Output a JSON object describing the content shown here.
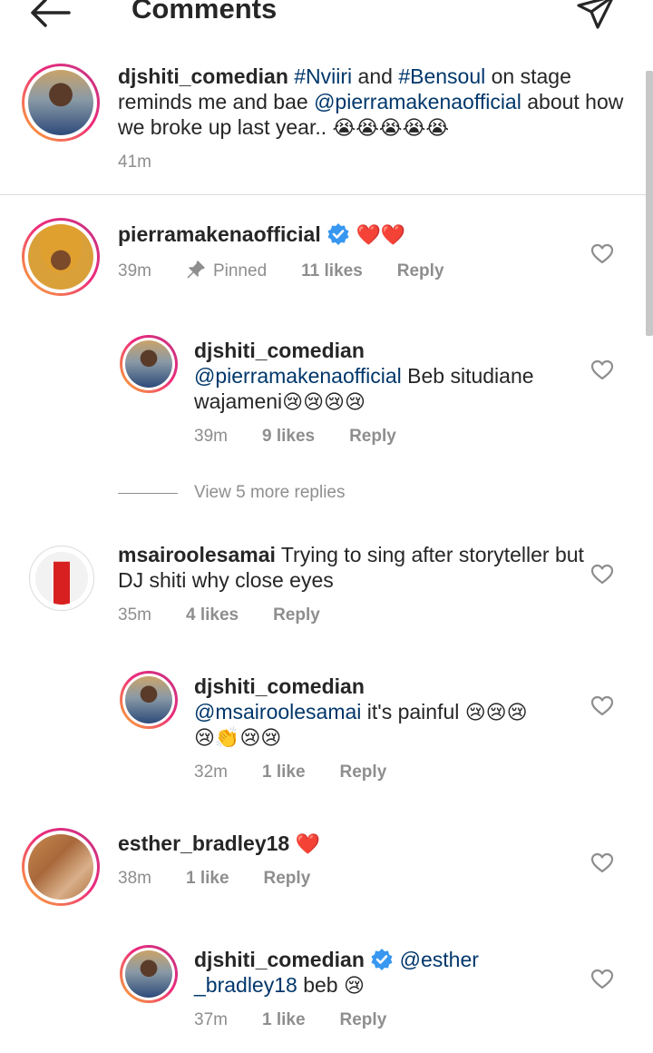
{
  "header": {
    "title": "Comments",
    "back_icon": "arrow-left-icon",
    "send_icon": "paper-plane-icon"
  },
  "caption": {
    "username": "djshiti_comedian",
    "tag1": "#Nviiri",
    "word_and": "and",
    "tag2": "#Bensoul",
    "text1": "on stage reminds me and bae",
    "mention": "@pierramakenaofficial",
    "text2": "about how we broke up last year..",
    "emojis": "😭😭😭😭😭",
    "time": "41m"
  },
  "comments": [
    {
      "username": "pierramakenaofficial",
      "verified": true,
      "text": "❤️❤️",
      "time": "39m",
      "pinned": "Pinned",
      "likes": "11 likes",
      "reply": "Reply",
      "replies": [
        {
          "username": "djshiti_comedian",
          "mention": "@pierramakenaofficial",
          "text": "Beb situdiane wajameni",
          "emojis": "😢😢😢😢",
          "time": "39m",
          "likes": "9 likes",
          "reply": "Reply"
        }
      ],
      "view_more": "View 5 more replies"
    },
    {
      "username": "msairoolesamai",
      "text": "Trying to sing after storyteller but DJ shiti why close eyes",
      "time": "35m",
      "likes": "4 likes",
      "reply": "Reply",
      "replies": [
        {
          "username": "djshiti_comedian",
          "mention": "@msairoolesamai",
          "text": "it's painful",
          "emojis1": "😢😢😢",
          "emojis2": "😢👏😢😢",
          "time": "32m",
          "likes": "1 like",
          "reply": "Reply"
        }
      ]
    },
    {
      "username": "esther_bradley18",
      "text": "❤️",
      "time": "38m",
      "likes": "1 like",
      "reply": "Reply",
      "replies": [
        {
          "username": "djshiti_comedian",
          "verified": true,
          "mention1": "@esther",
          "mention2": "_bradley18",
          "text": "beb",
          "emojis": "😢",
          "time": "37m",
          "likes": "1 like",
          "reply": "Reply"
        }
      ]
    }
  ],
  "colors": {
    "link": "#00376b",
    "meta": "#8e8e8e",
    "verified": "#3897f0",
    "heart_red": "#ed2f3c",
    "ring_start": "#f9b233",
    "ring_end": "#c13584"
  }
}
